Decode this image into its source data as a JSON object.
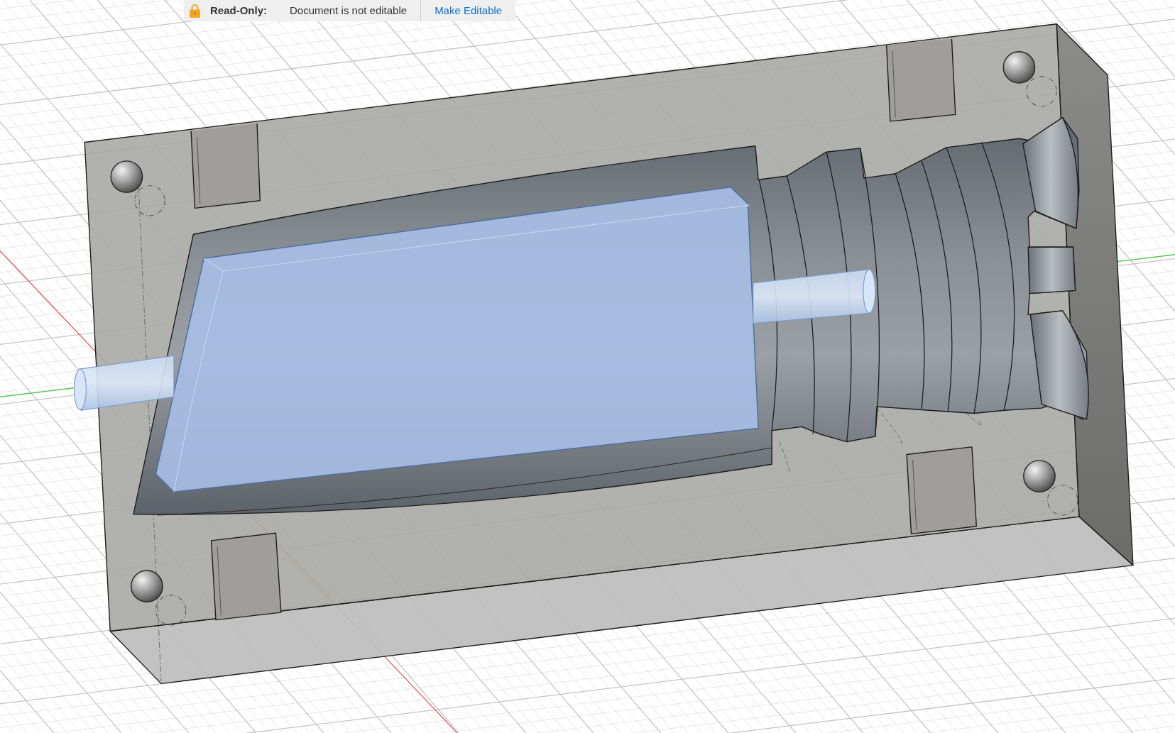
{
  "readonly_banner": {
    "label": "Read-Only:",
    "message": "Document is not editable",
    "action_link": "Make Editable"
  }
}
